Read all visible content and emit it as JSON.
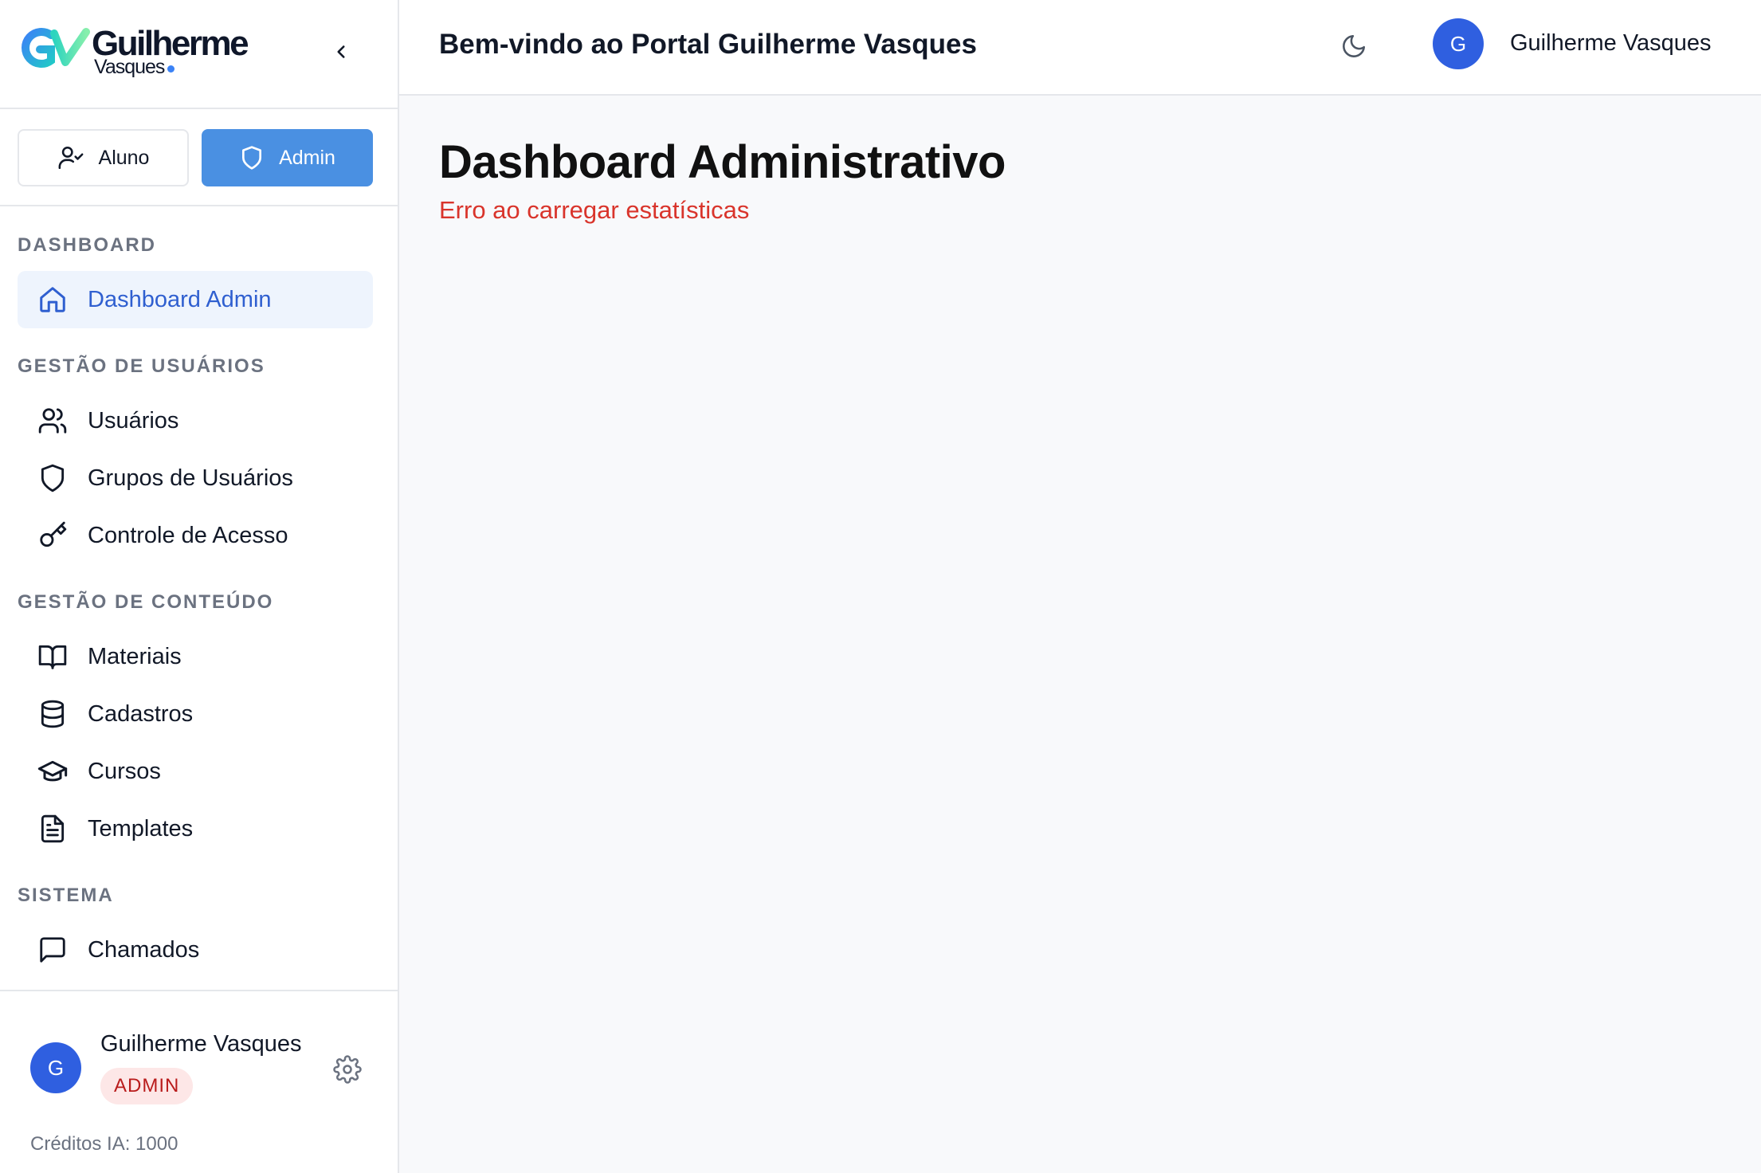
{
  "logo": {
    "line1": "Guilherme",
    "line2": "Vasques"
  },
  "role_switch": {
    "aluno_label": "Aluno",
    "admin_label": "Admin"
  },
  "sidebar": {
    "sections": [
      {
        "title": "DASHBOARD",
        "items": [
          {
            "label": "Dashboard Admin",
            "icon": "home-icon",
            "active": true
          }
        ]
      },
      {
        "title": "GESTÃO DE USUÁRIOS",
        "items": [
          {
            "label": "Usuários",
            "icon": "users-icon"
          },
          {
            "label": "Grupos de Usuários",
            "icon": "shield-icon"
          },
          {
            "label": "Controle de Acesso",
            "icon": "key-icon"
          }
        ]
      },
      {
        "title": "GESTÃO DE CONTEÚDO",
        "items": [
          {
            "label": "Materiais",
            "icon": "book-icon"
          },
          {
            "label": "Cadastros",
            "icon": "database-icon"
          },
          {
            "label": "Cursos",
            "icon": "graduation-cap-icon"
          },
          {
            "label": "Templates",
            "icon": "file-text-icon"
          }
        ]
      },
      {
        "title": "SISTEMA",
        "items": [
          {
            "label": "Chamados",
            "icon": "message-square-icon"
          }
        ]
      }
    ]
  },
  "user_card": {
    "avatar_initial": "G",
    "name": "Guilherme Vasques",
    "role_badge": "ADMIN",
    "credits": "Créditos IA: 1000"
  },
  "header": {
    "welcome": "Bem-vindo ao Portal Guilherme Vasques",
    "avatar_initial": "G",
    "user_name": "Guilherme Vasques",
    "theme_icon": "moon-icon"
  },
  "main": {
    "title": "Dashboard Administrativo",
    "error": "Erro ao carregar estatísticas"
  },
  "colors": {
    "accent": "#4a90e2",
    "active_text": "#2f5fd0",
    "active_bg": "#eef4fd",
    "avatar": "#2f5fe0",
    "error": "#d9342b",
    "badge_bg": "#fde7e7",
    "badge_text": "#b91c1c"
  }
}
